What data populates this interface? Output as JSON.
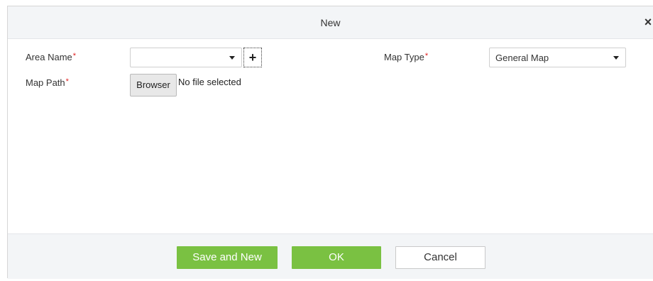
{
  "dialog": {
    "title": "New",
    "close_glyph": "×"
  },
  "form": {
    "area_name": {
      "label": "Area Name",
      "required_mark": "*",
      "value": "",
      "add_glyph": "+"
    },
    "map_type": {
      "label": "Map Type",
      "required_mark": "*",
      "value": "General Map"
    },
    "map_path": {
      "label": "Map Path",
      "required_mark": "*",
      "browse_label": "Browser",
      "file_status": "No file selected"
    }
  },
  "footer": {
    "save_new_label": "Save and New",
    "ok_label": "OK",
    "cancel_label": "Cancel"
  },
  "colors": {
    "primary_button": "#7ac142",
    "required": "#e02020",
    "header_bg": "#f3f5f7"
  },
  "icons": {
    "close": "close-icon",
    "dropdown": "chevron-down-icon",
    "add": "plus-icon"
  }
}
